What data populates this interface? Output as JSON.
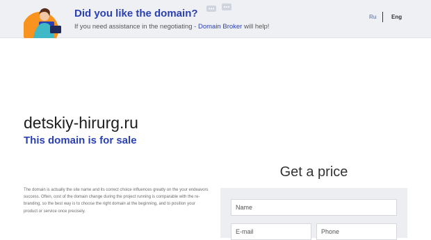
{
  "banner": {
    "title": "Did you like the domain?",
    "subtitle_before": "If you need assistance in the negotiating - ",
    "subtitle_link": "Domain Broker",
    "subtitle_after": " will help!"
  },
  "languages": {
    "ru": "Ru",
    "eng": "Eng"
  },
  "main": {
    "domain": "detskiy-hirurg.ru",
    "sale_text": "This domain is for sale",
    "description": "The domain is actually the site name and its correct choice influences greatly on the your endeavors success. Often, cost of the domain change during the project running is comparable with the re-branding, so the best way is to choose the right domain at the beginning, and to position your product or service once precisely."
  },
  "form": {
    "title": "Get a price",
    "name_placeholder": "Name",
    "email_placeholder": "E-mail",
    "phone_placeholder": "Phone"
  },
  "colors": {
    "accent": "#2a3fb3",
    "banner_bg": "#eef0f4",
    "panel_bg": "#edeef2"
  }
}
